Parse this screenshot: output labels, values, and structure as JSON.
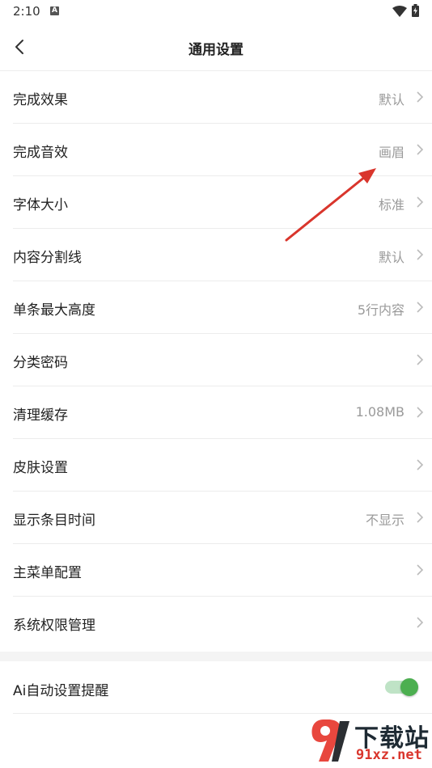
{
  "status_bar": {
    "time": "2:10",
    "notification_icon": "a-icon",
    "wifi_icon": "wifi-icon",
    "battery_icon": "battery-charging-icon"
  },
  "header": {
    "title": "通用设置",
    "back_icon": "chevron-left-icon"
  },
  "settings": {
    "items": [
      {
        "label": "完成效果",
        "value": "默认"
      },
      {
        "label": "完成音效",
        "value": "画眉"
      },
      {
        "label": "字体大小",
        "value": "标准"
      },
      {
        "label": "内容分割线",
        "value": "默认"
      },
      {
        "label": "单条最大高度",
        "value": "5行内容"
      },
      {
        "label": "分类密码",
        "value": ""
      },
      {
        "label": "清理缓存",
        "value": "1.08MB"
      },
      {
        "label": "皮肤设置",
        "value": ""
      },
      {
        "label": "显示条目时间",
        "value": "不显示"
      },
      {
        "label": "主菜单配置",
        "value": ""
      },
      {
        "label": "系统权限管理",
        "value": ""
      }
    ]
  },
  "toggle_setting": {
    "label": "Ai自动设置提醒",
    "enabled": true
  },
  "watermark": {
    "logo_text": "下载站",
    "url": "91xz.net"
  },
  "colors": {
    "accent_green": "#4caf50",
    "annotation_red": "#d9352c"
  }
}
